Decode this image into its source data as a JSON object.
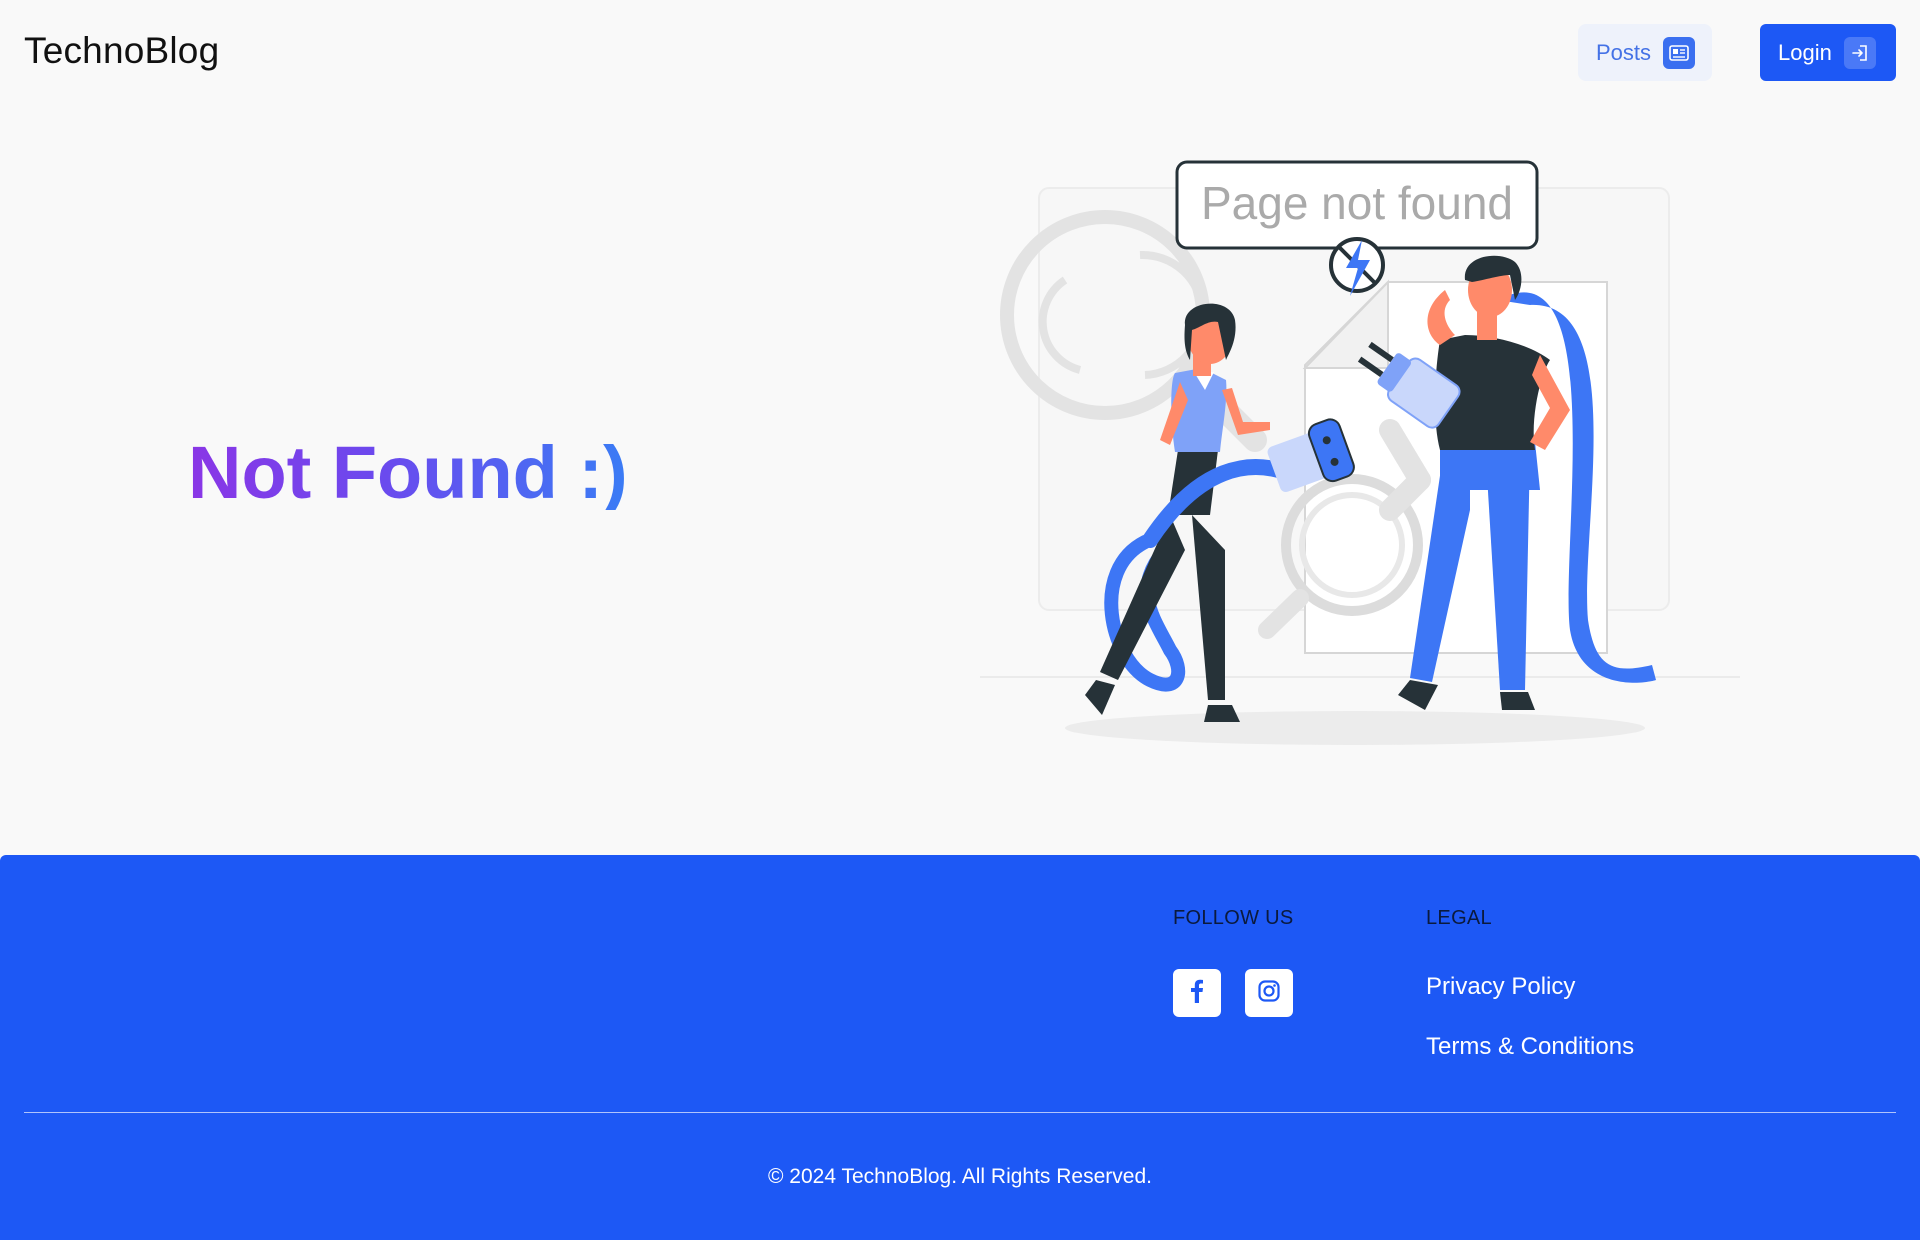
{
  "header": {
    "logo": "TechnoBlog",
    "posts_label": "Posts",
    "login_label": "Login"
  },
  "hero": {
    "title": "Not Found :)"
  },
  "illustration": {
    "sign_text": "Page not found"
  },
  "footer": {
    "follow_heading": "FOLLOW US",
    "legal_heading": "LEGAL",
    "privacy_label": "Privacy Policy",
    "terms_label": "Terms & Conditions",
    "copyright": "© 2024 TechnoBlog. All Rights Reserved."
  },
  "colors": {
    "accent": "#1d58f5",
    "page_bg": "#f9f9f9",
    "gradient_start": "#8a36e6",
    "gradient_end": "#3a7cf5"
  },
  "icons": {
    "posts": "newspaper-icon",
    "login": "login-icon",
    "social_1": "facebook-icon",
    "social_2": "instagram-icon"
  }
}
